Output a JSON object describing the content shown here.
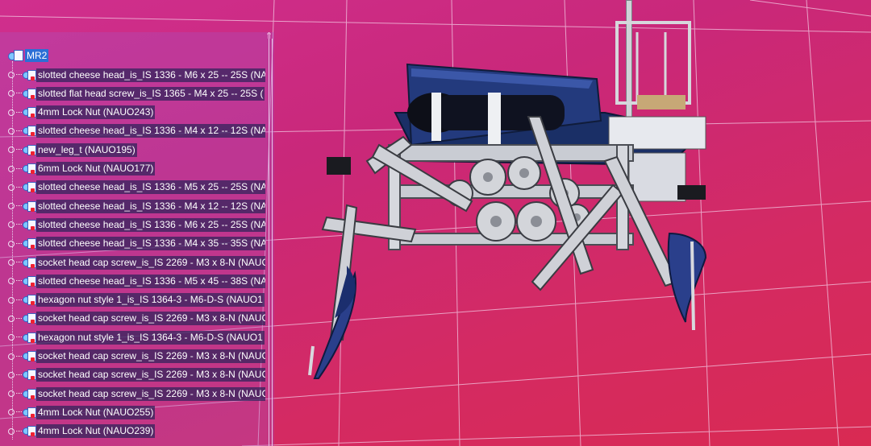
{
  "tree": {
    "root_label": "MR2",
    "items": [
      {
        "label": "slotted cheese head_is_IS 1336 - M6 x 25 -- 25S (NA"
      },
      {
        "label": "slotted flat head screw_is_IS 1365 - M4 x 25 -- 25S ("
      },
      {
        "label": "4mm Lock Nut (NAUO243)"
      },
      {
        "label": "slotted cheese head_is_IS 1336 - M4 x 12 -- 12S (NA"
      },
      {
        "label": "new_leg_t (NAUO195)"
      },
      {
        "label": "6mm Lock Nut (NAUO177)"
      },
      {
        "label": "slotted cheese head_is_IS 1336 - M5 x 25 -- 25S (NA"
      },
      {
        "label": "slotted cheese head_is_IS 1336 - M4 x 12 -- 12S (NA"
      },
      {
        "label": "slotted cheese head_is_IS 1336 - M6 x 25 -- 25S (NA"
      },
      {
        "label": "slotted cheese head_is_IS 1336 - M4 x 35 -- 35S (NA"
      },
      {
        "label": "socket head cap screw_is_IS 2269 - M3 x 8-N (NAUC"
      },
      {
        "label": "slotted cheese head_is_IS 1336 - M5 x 45 -- 38S (NA"
      },
      {
        "label": "hexagon nut style 1_is_IS 1364-3 - M6-D-S (NAUO1"
      },
      {
        "label": "socket head cap screw_is_IS 2269 - M3 x 8-N (NAUC"
      },
      {
        "label": "hexagon nut style 1_is_IS 1364-3 - M6-D-S (NAUO1"
      },
      {
        "label": "socket head cap screw_is_IS 2269 - M3 x 8-N (NAUC"
      },
      {
        "label": "socket head cap screw_is_IS 2269 - M3 x 8-N (NAUC"
      },
      {
        "label": "socket head cap screw_is_IS 2269 - M3 x 8-N (NAUC"
      },
      {
        "label": "4mm Lock Nut (NAUO255)"
      },
      {
        "label": "4mm Lock Nut (NAUO239)"
      }
    ]
  },
  "colors": {
    "background_top": "#d02f8e",
    "background_bottom": "#d92a52",
    "selection": "#2b6fd6",
    "label_bg": "#2d235a"
  },
  "icons": {
    "part": "product-part-icon",
    "root": "assembly-root-icon"
  }
}
